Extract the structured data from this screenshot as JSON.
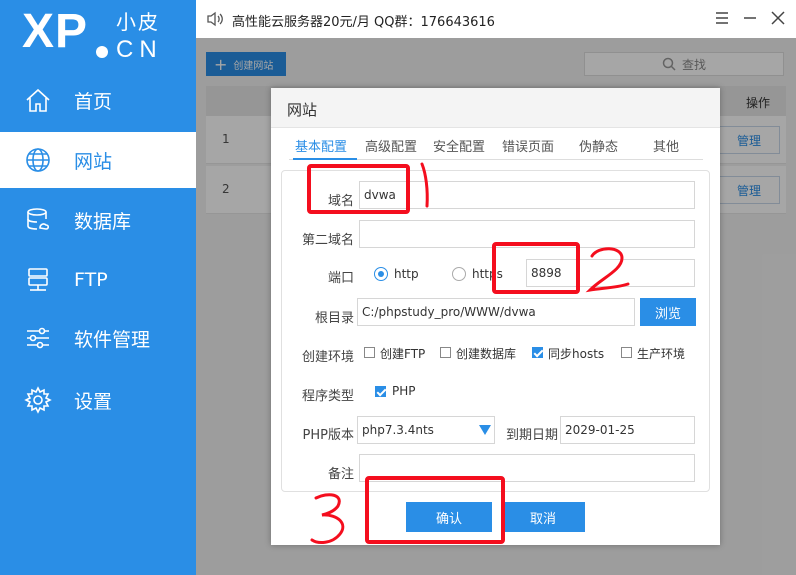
{
  "logo": {
    "big": "XP",
    "cn": "小皮",
    "en": "CN"
  },
  "nav": [
    {
      "label": "首页",
      "icon": "home-icon"
    },
    {
      "label": "网站",
      "icon": "globe-icon",
      "active": true
    },
    {
      "label": "数据库",
      "icon": "database-icon"
    },
    {
      "label": "FTP",
      "icon": "ftp-icon"
    },
    {
      "label": "软件管理",
      "icon": "sliders-icon"
    },
    {
      "label": "设置",
      "icon": "gear-icon"
    }
  ],
  "topbar": {
    "notice": "高性能云服务器20元/月  QQ群：176643616"
  },
  "main": {
    "create_label": "创建网站",
    "search_label": "查找",
    "op_header": "操作",
    "rows": [
      {
        "num": "1",
        "manage": "管理"
      },
      {
        "num": "2",
        "manage": "管理"
      }
    ]
  },
  "dialog": {
    "title": "网站",
    "tabs": [
      "基本配置",
      "高级配置",
      "安全配置",
      "错误页面",
      "伪静态",
      "其他"
    ],
    "domain_label": "域名",
    "domain_value": "dvwa",
    "second_domain_label": "第二域名",
    "second_domain_value": "",
    "port_label": "端口",
    "http_label": "http",
    "https_label": "https",
    "port_value": "8898",
    "root_label": "根目录",
    "root_value": "C:/phpstudy_pro/WWW/dvwa",
    "browse_label": "浏览",
    "env_label": "创建环境",
    "env_options": [
      {
        "label": "创建FTP",
        "checked": false
      },
      {
        "label": "创建数据库",
        "checked": false
      },
      {
        "label": "同步hosts",
        "checked": true
      },
      {
        "label": "生产环境",
        "checked": false
      }
    ],
    "program_label": "程序类型",
    "program_option": "PHP",
    "php_label": "PHP版本",
    "php_value": "php7.3.4nts",
    "expire_label": "到期日期",
    "expire_value": "2029-01-25",
    "note_label": "备注",
    "note_value": "",
    "confirm_label": "确认",
    "cancel_label": "取消"
  },
  "colors": {
    "accent": "#2a8ee6",
    "annotation": "#f40e1e"
  }
}
